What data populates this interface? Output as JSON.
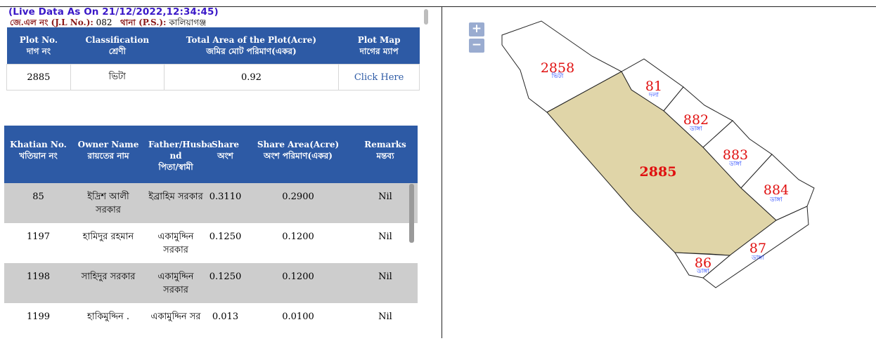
{
  "live_data": "(Live Data As On 21/12/2022,12:34:45)",
  "jl_label": "জে.এল নং (J.L No.):",
  "jl_value": "082",
  "ps_label": "থানা (P.S.):",
  "ps_value": "কালিয়াগঞ্জ",
  "plot_table": {
    "headers": [
      {
        "en": "Plot No.",
        "bn": "দাগ নং"
      },
      {
        "en": "Classification",
        "bn": "শ্রেণী"
      },
      {
        "en": "Total Area of the Plot(Acre)",
        "bn": "জমির মোট পরিমাণ(একর)"
      },
      {
        "en": "Plot Map",
        "bn": "দাগের ম্যাপ"
      }
    ],
    "row": {
      "plot_no": "2885",
      "classification": "ভিটা",
      "area": "0.92",
      "map_link": "Click Here"
    }
  },
  "owner_table": {
    "headers": [
      {
        "en": "Khatian No.",
        "bn": "খতিয়ান নং"
      },
      {
        "en": "Owner Name",
        "bn": "রায়তের নাম"
      },
      {
        "en": "Father/Husba nd",
        "bn": "পিতা/স্বামী"
      },
      {
        "en": "Share",
        "bn": "অংশ"
      },
      {
        "en": "Share Area(Acre)",
        "bn": "অংশ পরিমাণ(একর)"
      },
      {
        "en": "Remarks",
        "bn": "মন্তব্য"
      }
    ],
    "rows": [
      {
        "khatian": "85",
        "owner": "ইদ্রিশ আলী সরকার",
        "father": "ইব্রাহিম সরকার",
        "share": "0.3110",
        "share_area": "0.2900",
        "remarks": "Nil"
      },
      {
        "khatian": "1197",
        "owner": "হামিদুর রহমান",
        "father": "একামুদ্দিন সরকার",
        "share": "0.1250",
        "share_area": "0.1200",
        "remarks": "Nil"
      },
      {
        "khatian": "1198",
        "owner": "সাহিদুর সরকার",
        "father": "একামুদ্দিন সরকার",
        "share": "0.1250",
        "share_area": "0.1200",
        "remarks": "Nil"
      },
      {
        "khatian": "1199",
        "owner": "হাকিমুদ্দিন .",
        "father": "একামুদ্দিন সর",
        "share": "0.013",
        "share_area": "0.0100",
        "remarks": "Nil"
      }
    ]
  },
  "zoom": {
    "in": "+",
    "out": "−"
  },
  "map": {
    "highlight_color": "#e0d5a8",
    "label_color": "#e01010",
    "sub_color": "#1a3cff",
    "plots": [
      {
        "num": "2858",
        "type": "ভিটা"
      },
      {
        "num": "81",
        "type": "দলা"
      },
      {
        "num": "882",
        "type": "ডাঙ্গা"
      },
      {
        "num": "883",
        "type": "ডাঙ্গা"
      },
      {
        "num": "884",
        "type": "ডাঙ্গা"
      },
      {
        "num": "87",
        "type": "ডাঙ্গা"
      },
      {
        "num": "86",
        "type": "ডাঙ্গা"
      },
      {
        "num": "2885",
        "type": ""
      }
    ]
  }
}
